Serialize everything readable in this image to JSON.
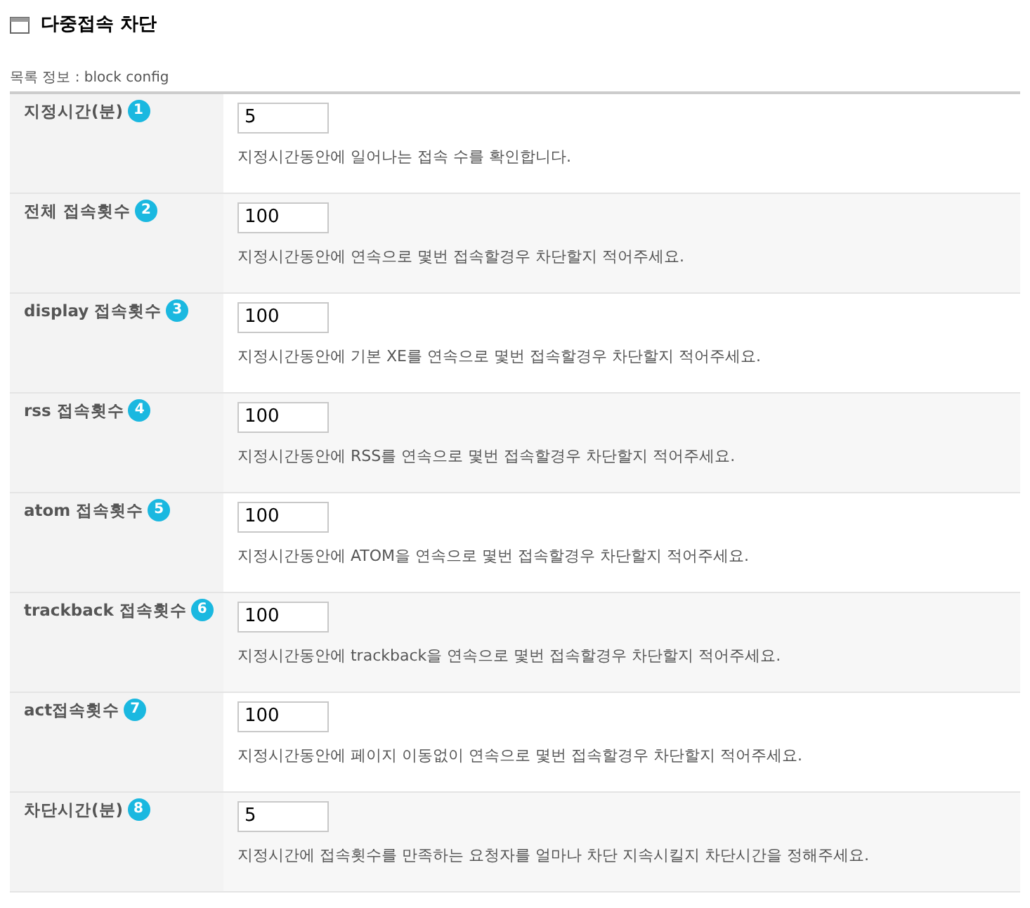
{
  "title": "다중접속 차단",
  "caption": "목록 정보 : block config",
  "rows": [
    {
      "label": "지정시간(분)",
      "badge": "1",
      "value": "5",
      "description": "지정시간동안에 일어나는 접속 수를 확인합니다."
    },
    {
      "label": "전체 접속횟수",
      "badge": "2",
      "value": "100",
      "description": "지정시간동안에 연속으로 몇번 접속할경우 차단할지 적어주세요."
    },
    {
      "label": "display 접속횟수",
      "badge": "3",
      "value": "100",
      "description": "지정시간동안에 기본 XE를 연속으로 몇번 접속할경우 차단할지 적어주세요."
    },
    {
      "label": "rss 접속횟수",
      "badge": "4",
      "value": "100",
      "description": "지정시간동안에 RSS를 연속으로 몇번 접속할경우 차단할지 적어주세요."
    },
    {
      "label": "atom 접속횟수",
      "badge": "5",
      "value": "100",
      "description": "지정시간동안에 ATOM을 연속으로 몇번 접속할경우 차단할지 적어주세요."
    },
    {
      "label": "trackback 접속횟수",
      "badge": "6",
      "value": "100",
      "description": "지정시간동안에 trackback을 연속으로 몇번 접속할경우 차단할지 적어주세요."
    },
    {
      "label": "act접속횟수",
      "badge": "7",
      "value": "100",
      "description": "지정시간동안에 페이지 이동없이 연속으로 몇번 접속할경우 차단할지 적어주세요."
    },
    {
      "label": "차단시간(분)",
      "badge": "8",
      "value": "5",
      "description": "지정시간에 접속횟수를 만족하는 요청자를 얼마나 차단 지속시킬지 차단시간을 정해주세요."
    }
  ]
}
